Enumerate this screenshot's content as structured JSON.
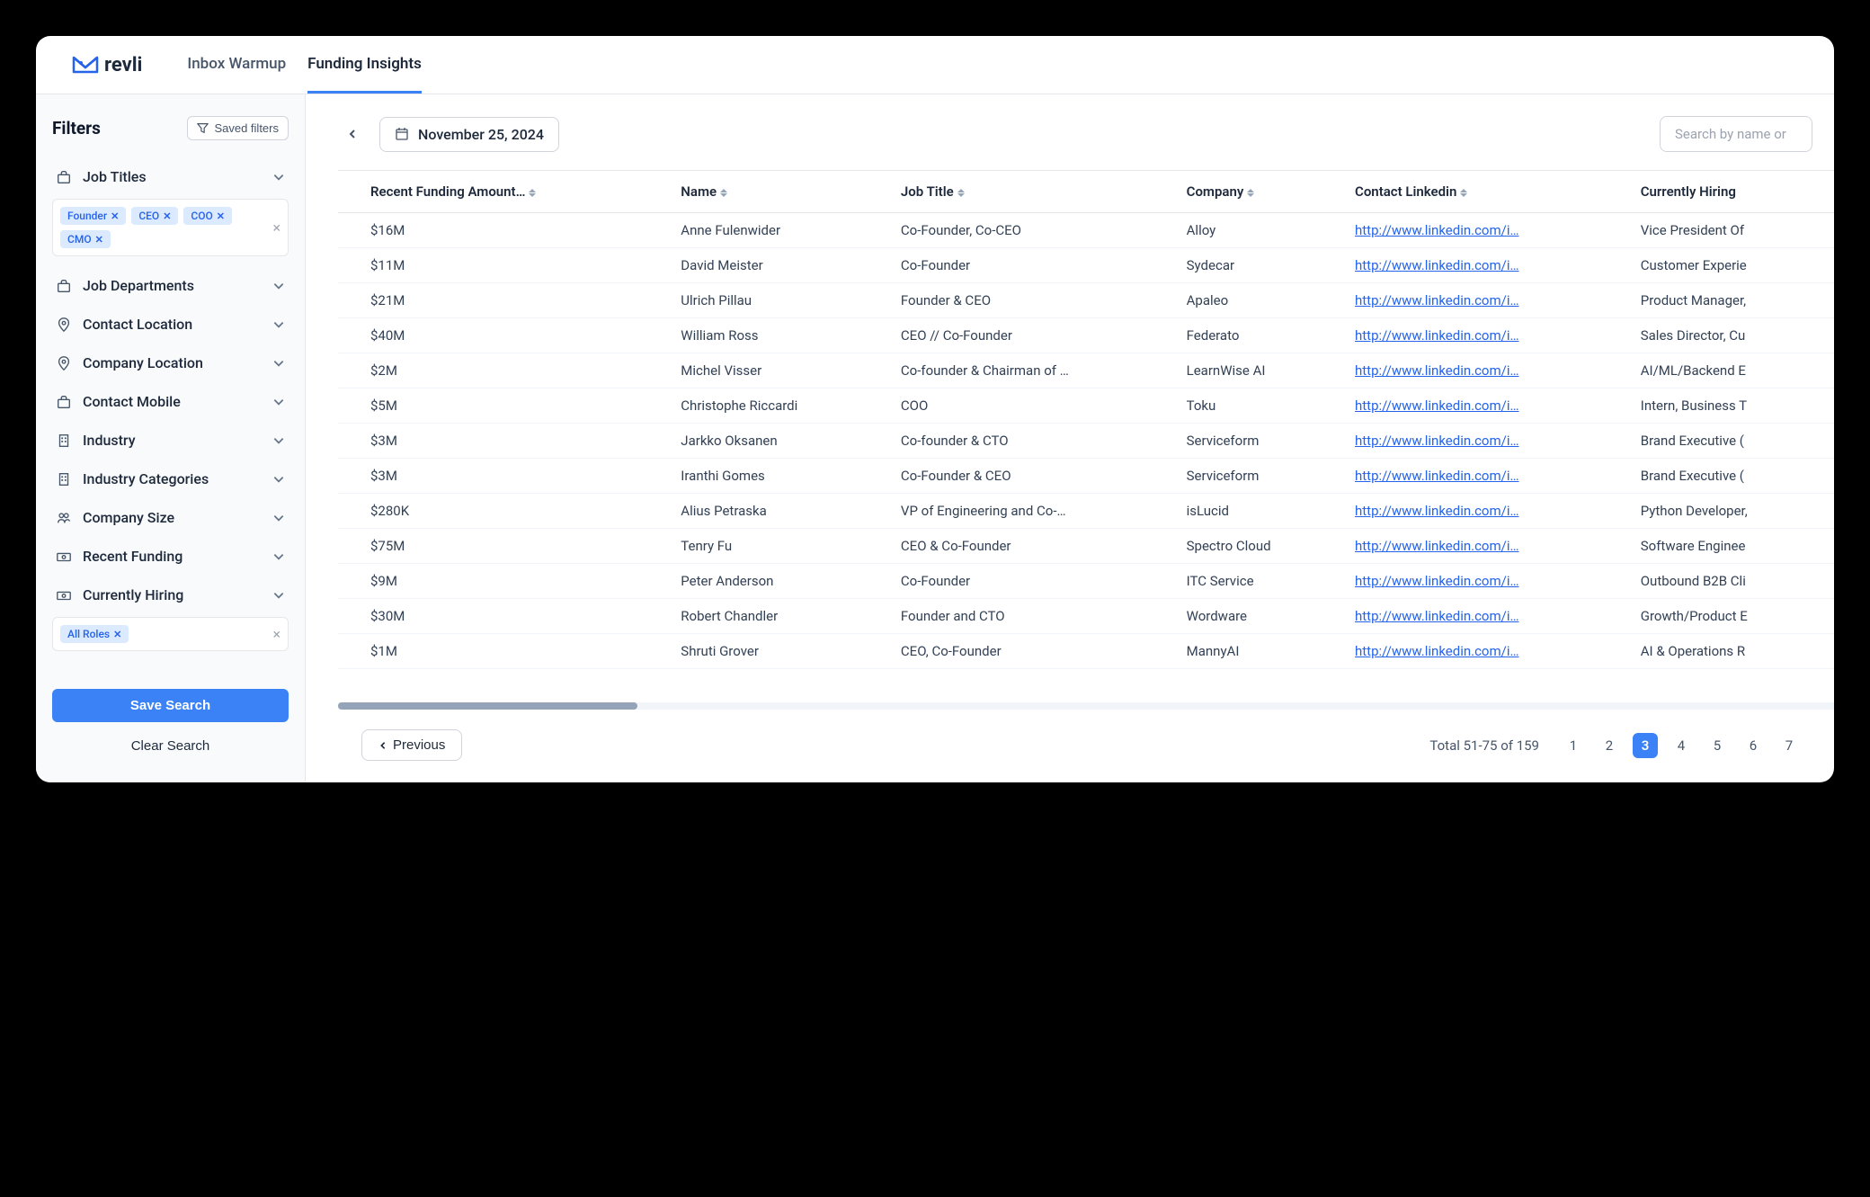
{
  "brand": {
    "name": "revli"
  },
  "nav": {
    "inbox_warmup": "Inbox Warmup",
    "funding_insights": "Funding Insights"
  },
  "filters": {
    "title": "Filters",
    "saved_filters_label": "Saved filters",
    "sections": {
      "job_titles": "Job Titles",
      "job_departments": "Job Departments",
      "contact_location": "Contact Location",
      "company_location": "Company Location",
      "contact_mobile": "Contact Mobile",
      "industry": "Industry",
      "industry_categories": "Industry Categories",
      "company_size": "Company Size",
      "recent_funding": "Recent Funding",
      "currently_hiring": "Currently Hiring"
    },
    "job_title_tags": [
      "Founder",
      "CEO",
      "COO",
      "CMO"
    ],
    "hiring_tags": [
      "All Roles"
    ],
    "save_search_label": "Save Search",
    "clear_search_label": "Clear Search"
  },
  "toolbar": {
    "date": "November 25, 2024",
    "search_placeholder": "Search by name or"
  },
  "table": {
    "columns": {
      "funding": "Recent Funding Amount…",
      "name": "Name",
      "job_title": "Job Title",
      "company": "Company",
      "linkedin": "Contact Linkedin",
      "hiring": "Currently Hiring"
    },
    "linkedin_text": "http://www.linkedin.com/i…",
    "rows": [
      {
        "funding": "$16M",
        "name": "Anne Fulenwider",
        "job_title": "Co-Founder, Co-CEO",
        "company": "Alloy",
        "hiring": "Vice President Of "
      },
      {
        "funding": "$11M",
        "name": "David Meister",
        "job_title": "Co-Founder",
        "company": "Sydecar",
        "hiring": "Customer Experie"
      },
      {
        "funding": "$21M",
        "name": "Ulrich Pillau",
        "job_title": "Founder & CEO",
        "company": "Apaleo",
        "hiring": "Product Manager, "
      },
      {
        "funding": "$40M",
        "name": "William Ross",
        "job_title": "CEO // Co-Founder",
        "company": "Federato",
        "hiring": "Sales Director, Cu"
      },
      {
        "funding": "$2M",
        "name": "Michel Visser",
        "job_title": "Co-founder & Chairman of …",
        "company": "LearnWise AI",
        "hiring": "AI/ML/Backend E"
      },
      {
        "funding": "$5M",
        "name": "Christophe Riccardi",
        "job_title": "COO",
        "company": "Toku",
        "hiring": "Intern, Business T"
      },
      {
        "funding": "$3M",
        "name": "Jarkko Oksanen",
        "job_title": "Co-founder & CTO",
        "company": "Serviceform",
        "hiring": "Brand Executive ("
      },
      {
        "funding": "$3M",
        "name": "Iranthi Gomes",
        "job_title": "Co-Founder & CEO",
        "company": "Serviceform",
        "hiring": "Brand Executive ("
      },
      {
        "funding": "$280K",
        "name": "Alius Petraska",
        "job_title": "VP of Engineering and Co-…",
        "company": "isLucid",
        "hiring": "Python Developer,"
      },
      {
        "funding": "$75M",
        "name": "Tenry Fu",
        "job_title": "CEO & Co-Founder",
        "company": "Spectro Cloud",
        "hiring": "Software Enginee"
      },
      {
        "funding": "$9M",
        "name": "Peter Anderson",
        "job_title": "Co-Founder",
        "company": "ITC Service",
        "hiring": "Outbound B2B Cli"
      },
      {
        "funding": "$30M",
        "name": "Robert Chandler",
        "job_title": "Founder and CTO",
        "company": "Wordware",
        "hiring": "Growth/Product E"
      },
      {
        "funding": "$1M",
        "name": "Shruti Grover",
        "job_title": "CEO, Co-Founder",
        "company": "MannyAI",
        "hiring": "AI & Operations R"
      }
    ]
  },
  "pagination": {
    "previous_label": "Previous",
    "total_text": "Total 51-75 of 159",
    "pages": [
      "1",
      "2",
      "3",
      "4",
      "5",
      "6",
      "7"
    ],
    "active_page": "3"
  }
}
